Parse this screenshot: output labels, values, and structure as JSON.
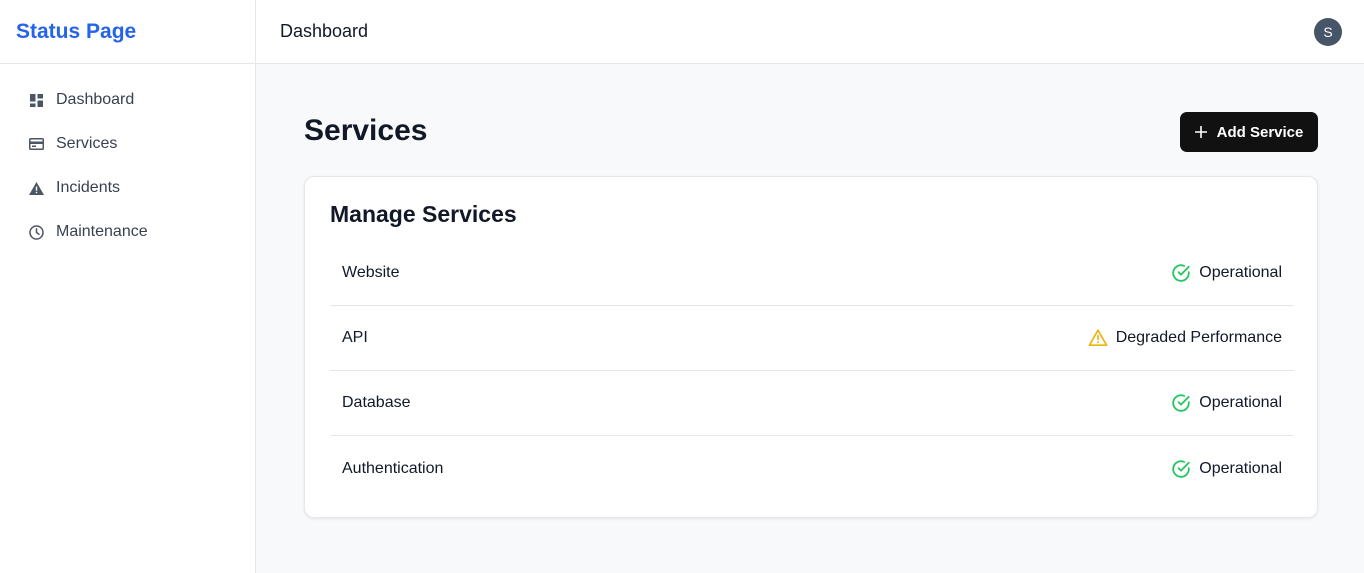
{
  "brand": {
    "title": "Status Page",
    "color": "#2563eb"
  },
  "sidebar": {
    "items": [
      {
        "label": "Dashboard",
        "icon": "dashboard-grid-icon"
      },
      {
        "label": "Services",
        "icon": "server-icon"
      },
      {
        "label": "Incidents",
        "icon": "warning-triangle-icon"
      },
      {
        "label": "Maintenance",
        "icon": "clock-icon"
      }
    ]
  },
  "header": {
    "breadcrumb": "Dashboard",
    "avatar_initial": "S"
  },
  "main": {
    "title": "Services",
    "add_button_label": "Add Service",
    "card_title": "Manage Services",
    "services": [
      {
        "name": "Website",
        "status": "Operational",
        "status_icon": "check-circle-icon",
        "status_color": "#22c55e"
      },
      {
        "name": "API",
        "status": "Degraded Performance",
        "status_icon": "warning-triangle-icon",
        "status_color": "#eab308"
      },
      {
        "name": "Database",
        "status": "Operational",
        "status_icon": "check-circle-icon",
        "status_color": "#22c55e"
      },
      {
        "name": "Authentication",
        "status": "Operational",
        "status_icon": "check-circle-icon",
        "status_color": "#22c55e"
      }
    ]
  }
}
